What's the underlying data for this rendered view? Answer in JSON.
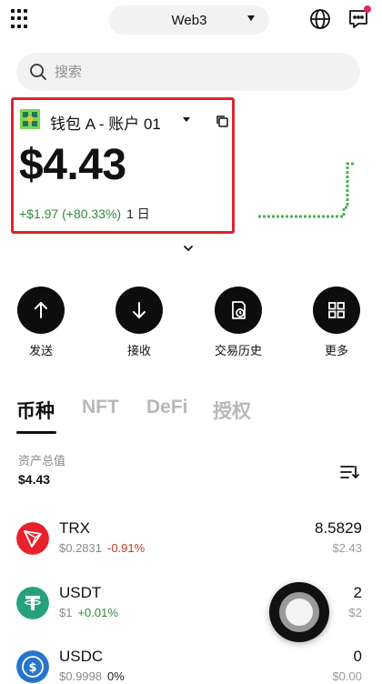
{
  "header": {
    "network_label": "Web3",
    "menu_icon": "grid-menu-icon",
    "globe_icon": "globe-icon",
    "chat_icon": "chat-icon"
  },
  "search": {
    "placeholder": "搜索"
  },
  "account": {
    "wallet_name": "钱包 A - 账户 01",
    "balance": "$4.43",
    "change_amount": "+$1.97 (+80.33%)",
    "change_period": "1 日"
  },
  "actions": [
    {
      "label": "发送",
      "icon": "arrow-up-icon"
    },
    {
      "label": "接收",
      "icon": "arrow-down-icon"
    },
    {
      "label": "交易历史",
      "icon": "history-icon"
    },
    {
      "label": "更多",
      "icon": "grid-icon"
    }
  ],
  "asset_tabs": [
    "币种",
    "NFT",
    "DeFi",
    "授权"
  ],
  "assets": {
    "total_label": "资产总值",
    "total_value": "$4.43"
  },
  "tokens": [
    {
      "symbol": "TRX",
      "price": "$0.2831",
      "change": "-0.91%",
      "amount": "8.5829",
      "fiat": "$2.43"
    },
    {
      "symbol": "USDT",
      "price": "$1",
      "change": "+0.01%",
      "amount": "2",
      "fiat": "$2"
    },
    {
      "symbol": "USDC",
      "price": "$0.9998",
      "change": "0%",
      "amount": "0",
      "fiat": "$0.00"
    }
  ],
  "colors": {
    "positive": "#2e8b3a",
    "negative": "#c0392b",
    "highlight_border": "#e0242a",
    "trx_red": "#e8222d",
    "usdt_green": "#26a17b",
    "usdc_blue": "#2775ca"
  }
}
